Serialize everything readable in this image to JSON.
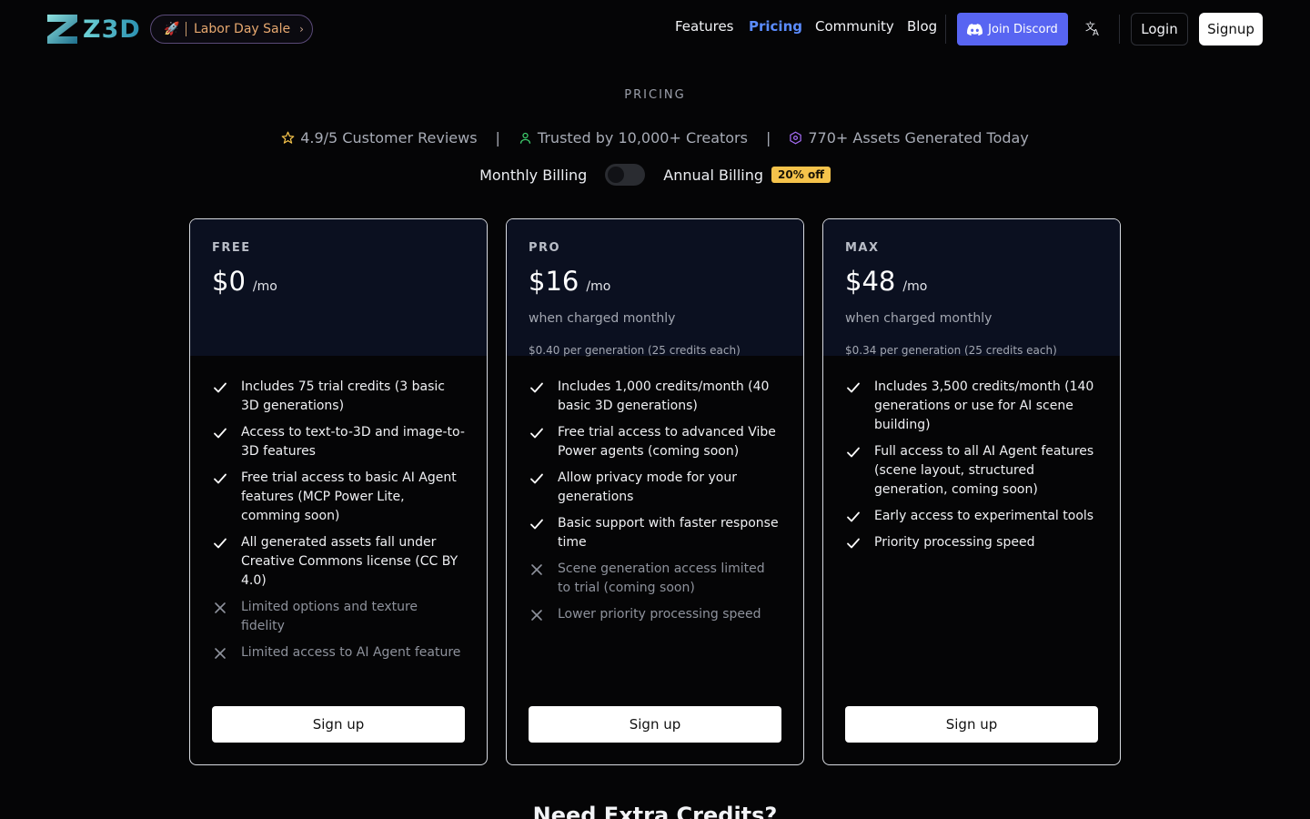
{
  "header": {
    "logo_text": "Z3D",
    "sale": {
      "label": "Labor Day Sale"
    },
    "nav": [
      {
        "label": "Features"
      },
      {
        "label": "Pricing",
        "active": true
      },
      {
        "label": "Community"
      },
      {
        "label": "Blog"
      }
    ],
    "discord_label": "Join Discord",
    "login_label": "Login",
    "signup_label": "Signup"
  },
  "hero": {
    "section_label": "PRICING",
    "stats": [
      {
        "icon": "star-icon",
        "text": "4.9/5 Customer Reviews"
      },
      {
        "icon": "user-icon",
        "text": "Trusted by 10,000+ Creators"
      },
      {
        "icon": "cube-icon",
        "text": "770+ Assets Generated Today"
      }
    ],
    "stat_separator": "|",
    "billing": {
      "monthly_label": "Monthly Billing",
      "annual_label": "Annual Billing",
      "discount_badge": "20% off",
      "annual_selected": false
    }
  },
  "plans": [
    {
      "tier": "FREE",
      "price": "$0",
      "per": "/mo",
      "charged": "",
      "per_generation": "",
      "features": [
        {
          "text": "Includes 75 trial credits (3 basic 3D generations)",
          "included": true
        },
        {
          "text": "Access to text-to-3D and image-to-3D features",
          "included": true
        },
        {
          "text": "Free trial access to basic AI Agent features (MCP Power Lite, comming soon)",
          "included": true
        },
        {
          "text": "All generated assets fall under Creative Commons license (CC BY 4.0)",
          "included": true
        },
        {
          "text": "Limited options and texture fidelity",
          "included": false
        },
        {
          "text": "Limited access to AI Agent feature",
          "included": false
        }
      ],
      "cta": "Sign up"
    },
    {
      "tier": "PRO",
      "price": "$16",
      "per": "/mo",
      "charged": "when charged monthly",
      "per_generation": "$0.40 per generation (25 credits each)",
      "features": [
        {
          "text": "Includes 1,000 credits/month (40 basic 3D generations)",
          "included": true
        },
        {
          "text": "Free trial access to advanced Vibe Power agents (coming soon)",
          "included": true
        },
        {
          "text": "Allow privacy mode for your generations",
          "included": true
        },
        {
          "text": "Basic support with faster response time",
          "included": true
        },
        {
          "text": "Scene generation access limited to trial (coming soon)",
          "included": false
        },
        {
          "text": "Lower priority processing speed",
          "included": false
        }
      ],
      "cta": "Sign up"
    },
    {
      "tier": "MAX",
      "price": "$48",
      "per": "/mo",
      "charged": "when charged monthly",
      "per_generation": "$0.34 per generation (25 credits each)",
      "features": [
        {
          "text": "Includes 3,500 credits/month (140 generations or use for AI scene building)",
          "included": true
        },
        {
          "text": "Full access to all AI Agent features (scene layout, structured generation, coming soon)",
          "included": true
        },
        {
          "text": "Early access to experimental tools",
          "included": true
        },
        {
          "text": "Priority processing speed",
          "included": true
        }
      ],
      "cta": "Sign up"
    }
  ],
  "extra": {
    "title": "Need Extra Credits?"
  },
  "colors": {
    "background": "#050506",
    "card_head": "#0b1020",
    "accent_nav": "#5b8cff",
    "discord": "#5865f2",
    "badge": "#f5c34b",
    "sale_text": "#e7a86f"
  }
}
